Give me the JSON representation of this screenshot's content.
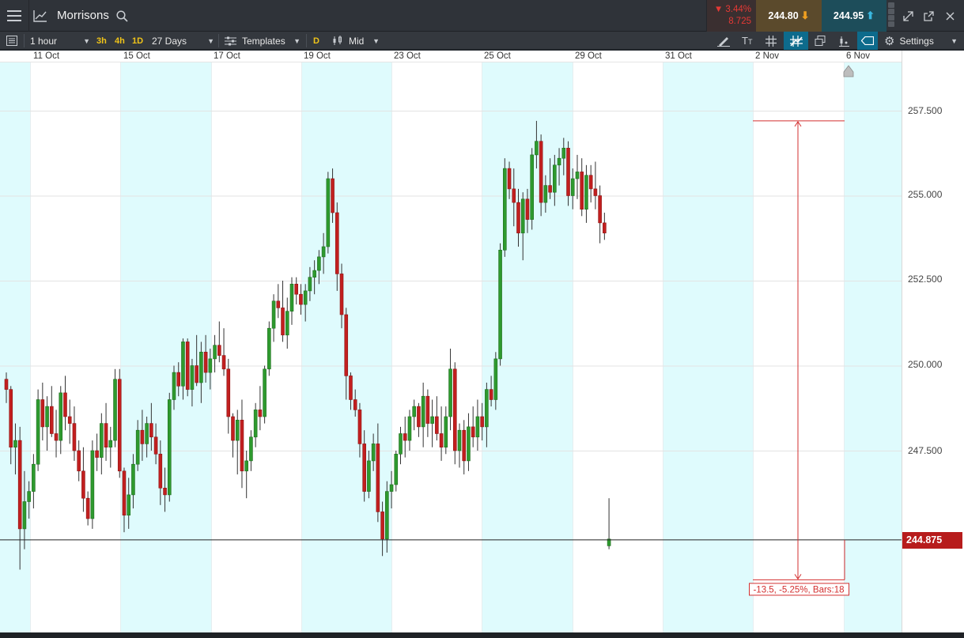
{
  "header": {
    "symbol": "Morrisons",
    "change_pct": "3.44%",
    "change_abs": "8.725",
    "sell_price": "244.80",
    "buy_price": "244.95",
    "down_color": "#e53935",
    "sell_bg": "#5b4a2c",
    "buy_bg": "#1d4d5a"
  },
  "toolbar": {
    "interval": "1 hour",
    "quick_intervals": [
      "3h",
      "4h",
      "1D"
    ],
    "range": "27 Days",
    "templates_label": "Templates",
    "d_button": "D",
    "price_type": "Mid",
    "settings_label": "Settings"
  },
  "icons": [
    "menu-icon",
    "chart-line-icon",
    "search-icon",
    "arrow-down-icon",
    "arrow-up-icon",
    "expand-icon",
    "popout-icon",
    "close-icon",
    "list-icon",
    "templates-icon",
    "candles-icon",
    "pen-icon",
    "text-icon",
    "grid-icon",
    "indicator-icon",
    "layers-icon",
    "bar-chart-icon",
    "tag-icon",
    "gear-icon"
  ],
  "chart_data": {
    "type": "candlestick",
    "x_labels": [
      "11 Oct",
      "15 Oct",
      "17 Oct",
      "19 Oct",
      "23 Oct",
      "25 Oct",
      "29 Oct",
      "31 Oct",
      "2 Nov",
      "6 Nov"
    ],
    "y_ticks": [
      "257.500",
      "255.000",
      "252.500",
      "250.000",
      "247.500"
    ],
    "ylim": [
      242.0,
      258.5
    ],
    "current_price": 244.875,
    "current_price_label": "244.875",
    "up_color": "#2e9a2e",
    "down_color": "#c21f1f",
    "measure": {
      "label": "-13.5, -5.25%, Bars:18",
      "from_price": 257.2,
      "to_price": 243.7
    },
    "candles": [
      [
        249.6,
        249.8,
        248.9,
        249.3
      ],
      [
        249.3,
        249.4,
        247.1,
        247.6
      ],
      [
        247.6,
        248.3,
        246.8,
        247.8
      ],
      [
        247.8,
        248.2,
        244.0,
        245.2
      ],
      [
        245.2,
        246.9,
        244.6,
        246.0
      ],
      [
        246.0,
        246.6,
        245.5,
        246.3
      ],
      [
        246.3,
        247.4,
        245.8,
        247.1
      ],
      [
        247.1,
        249.3,
        246.9,
        249.0
      ],
      [
        249.0,
        249.5,
        247.8,
        248.2
      ],
      [
        248.2,
        249.1,
        247.5,
        248.8
      ],
      [
        248.8,
        249.4,
        247.9,
        248.0
      ],
      [
        248.0,
        248.7,
        247.3,
        247.8
      ],
      [
        247.8,
        249.4,
        247.4,
        249.2
      ],
      [
        249.2,
        249.7,
        248.1,
        248.5
      ],
      [
        248.5,
        249.0,
        247.7,
        248.3
      ],
      [
        248.3,
        248.8,
        247.2,
        247.5
      ],
      [
        247.5,
        247.8,
        246.6,
        246.9
      ],
      [
        246.9,
        247.6,
        245.7,
        246.1
      ],
      [
        246.1,
        246.3,
        245.3,
        245.5
      ],
      [
        245.5,
        247.8,
        245.2,
        247.5
      ],
      [
        247.5,
        248.0,
        246.9,
        247.3
      ],
      [
        247.3,
        248.6,
        246.8,
        248.3
      ],
      [
        248.3,
        248.9,
        247.2,
        247.6
      ],
      [
        247.6,
        248.2,
        247.0,
        247.8
      ],
      [
        247.8,
        249.9,
        247.6,
        249.6
      ],
      [
        249.6,
        249.9,
        246.7,
        246.9
      ],
      [
        246.9,
        247.0,
        245.1,
        245.6
      ],
      [
        245.6,
        246.7,
        245.2,
        246.2
      ],
      [
        246.2,
        247.4,
        245.8,
        247.1
      ],
      [
        247.1,
        248.4,
        246.9,
        248.1
      ],
      [
        248.1,
        248.7,
        247.2,
        247.7
      ],
      [
        247.7,
        248.5,
        247.3,
        248.3
      ],
      [
        248.3,
        248.9,
        247.5,
        247.9
      ],
      [
        247.9,
        248.3,
        247.1,
        247.4
      ],
      [
        247.4,
        247.8,
        245.9,
        246.4
      ],
      [
        246.4,
        247.0,
        245.7,
        246.2
      ],
      [
        246.2,
        249.2,
        246.0,
        249.0
      ],
      [
        249.0,
        250.0,
        248.7,
        249.8
      ],
      [
        249.8,
        250.1,
        249.1,
        249.4
      ],
      [
        249.4,
        250.8,
        249.0,
        250.7
      ],
      [
        250.7,
        250.8,
        249.1,
        249.3
      ],
      [
        249.3,
        250.2,
        248.8,
        250.0
      ],
      [
        250.0,
        250.9,
        249.4,
        249.5
      ],
      [
        249.5,
        250.7,
        248.9,
        250.4
      ],
      [
        250.4,
        250.9,
        249.5,
        249.8
      ],
      [
        249.8,
        250.5,
        249.3,
        250.2
      ],
      [
        250.2,
        250.9,
        249.8,
        250.6
      ],
      [
        250.6,
        251.3,
        250.1,
        250.3
      ],
      [
        250.3,
        251.1,
        249.7,
        249.9
      ],
      [
        249.9,
        250.2,
        248.0,
        248.5
      ],
      [
        248.5,
        248.6,
        247.3,
        247.8
      ],
      [
        247.8,
        248.7,
        246.8,
        248.4
      ],
      [
        248.4,
        249.0,
        246.4,
        246.9
      ],
      [
        246.9,
        247.5,
        246.1,
        247.2
      ],
      [
        247.2,
        248.1,
        246.9,
        247.9
      ],
      [
        247.9,
        248.9,
        247.6,
        248.7
      ],
      [
        248.7,
        249.4,
        248.1,
        248.5
      ],
      [
        248.5,
        250.0,
        248.3,
        249.9
      ],
      [
        249.9,
        251.3,
        249.7,
        251.1
      ],
      [
        251.1,
        252.1,
        250.7,
        251.9
      ],
      [
        251.9,
        252.4,
        251.4,
        251.7
      ],
      [
        251.7,
        252.5,
        250.7,
        250.9
      ],
      [
        250.9,
        252.0,
        250.5,
        251.6
      ],
      [
        251.6,
        252.6,
        251.2,
        252.4
      ],
      [
        252.4,
        252.6,
        251.8,
        252.1
      ],
      [
        252.1,
        252.4,
        251.5,
        251.8
      ],
      [
        251.8,
        252.4,
        251.3,
        252.2
      ],
      [
        252.2,
        252.9,
        251.9,
        252.6
      ],
      [
        252.6,
        253.1,
        252.1,
        252.8
      ],
      [
        252.8,
        253.4,
        252.4,
        253.2
      ],
      [
        253.2,
        253.9,
        252.7,
        253.5
      ],
      [
        253.5,
        255.7,
        253.3,
        255.5
      ],
      [
        255.5,
        255.8,
        254.2,
        254.5
      ],
      [
        254.5,
        254.8,
        252.2,
        252.7
      ],
      [
        252.7,
        253.0,
        251.1,
        251.5
      ],
      [
        251.5,
        251.7,
        249.0,
        249.7
      ],
      [
        249.7,
        249.8,
        248.7,
        249.0
      ],
      [
        249.0,
        249.3,
        248.5,
        248.7
      ],
      [
        248.7,
        248.9,
        247.3,
        247.7
      ],
      [
        247.7,
        248.1,
        246.0,
        246.3
      ],
      [
        246.3,
        247.5,
        246.1,
        247.2
      ],
      [
        247.2,
        248.0,
        246.9,
        247.7
      ],
      [
        247.7,
        248.3,
        245.4,
        245.7
      ],
      [
        245.7,
        246.0,
        244.4,
        244.9
      ],
      [
        244.9,
        246.6,
        244.5,
        246.3
      ],
      [
        246.3,
        246.9,
        245.8,
        246.5
      ],
      [
        246.5,
        247.5,
        246.3,
        247.4
      ],
      [
        247.4,
        248.2,
        247.1,
        248.0
      ],
      [
        248.0,
        248.5,
        247.3,
        247.8
      ],
      [
        247.8,
        248.7,
        247.5,
        248.5
      ],
      [
        248.5,
        249.0,
        248.1,
        248.8
      ],
      [
        248.8,
        248.9,
        247.9,
        248.2
      ],
      [
        248.2,
        249.5,
        247.6,
        249.1
      ],
      [
        249.1,
        249.3,
        247.9,
        248.3
      ],
      [
        248.3,
        249.0,
        247.6,
        248.5
      ],
      [
        248.5,
        249.1,
        247.8,
        248.0
      ],
      [
        248.0,
        248.8,
        247.2,
        247.6
      ],
      [
        247.6,
        248.8,
        247.4,
        248.5
      ],
      [
        248.5,
        250.5,
        248.1,
        249.9
      ],
      [
        249.9,
        250.1,
        247.1,
        247.5
      ],
      [
        247.5,
        248.3,
        247.0,
        248.1
      ],
      [
        248.1,
        248.4,
        246.8,
        247.2
      ],
      [
        247.2,
        248.6,
        246.9,
        248.2
      ],
      [
        248.2,
        248.8,
        247.6,
        247.9
      ],
      [
        247.9,
        249.0,
        247.5,
        248.5
      ],
      [
        248.5,
        248.9,
        247.8,
        248.2
      ],
      [
        248.2,
        249.5,
        247.6,
        249.3
      ],
      [
        249.3,
        249.7,
        248.8,
        249.0
      ],
      [
        249.0,
        250.4,
        248.7,
        250.2
      ],
      [
        250.2,
        253.6,
        250.0,
        253.4
      ],
      [
        253.4,
        256.1,
        253.2,
        255.8
      ],
      [
        255.8,
        256.0,
        254.9,
        255.2
      ],
      [
        255.2,
        255.8,
        254.1,
        254.8
      ],
      [
        254.8,
        255.2,
        253.5,
        253.9
      ],
      [
        253.9,
        255.1,
        253.1,
        254.9
      ],
      [
        254.9,
        255.2,
        253.9,
        254.3
      ],
      [
        254.3,
        256.4,
        254.0,
        256.2
      ],
      [
        256.2,
        257.2,
        255.8,
        256.6
      ],
      [
        256.6,
        256.8,
        254.4,
        254.8
      ],
      [
        254.8,
        255.6,
        254.5,
        255.3
      ],
      [
        255.3,
        256.1,
        254.9,
        255.1
      ],
      [
        255.1,
        256.2,
        254.7,
        255.9
      ],
      [
        255.9,
        256.4,
        255.3,
        256.1
      ],
      [
        256.1,
        256.7,
        255.6,
        256.4
      ],
      [
        256.4,
        256.6,
        254.7,
        255.0
      ],
      [
        255.0,
        255.8,
        254.6,
        255.5
      ],
      [
        255.5,
        256.2,
        254.9,
        255.7
      ],
      [
        255.7,
        256.1,
        254.4,
        254.6
      ],
      [
        254.6,
        255.9,
        254.2,
        255.6
      ],
      [
        255.6,
        255.9,
        254.8,
        255.2
      ],
      [
        255.2,
        256.0,
        254.6,
        255.0
      ],
      [
        255.0,
        255.3,
        253.6,
        254.2
      ],
      [
        254.2,
        254.5,
        253.7,
        253.9
      ],
      [
        244.7,
        246.1,
        244.6,
        244.9
      ]
    ]
  }
}
